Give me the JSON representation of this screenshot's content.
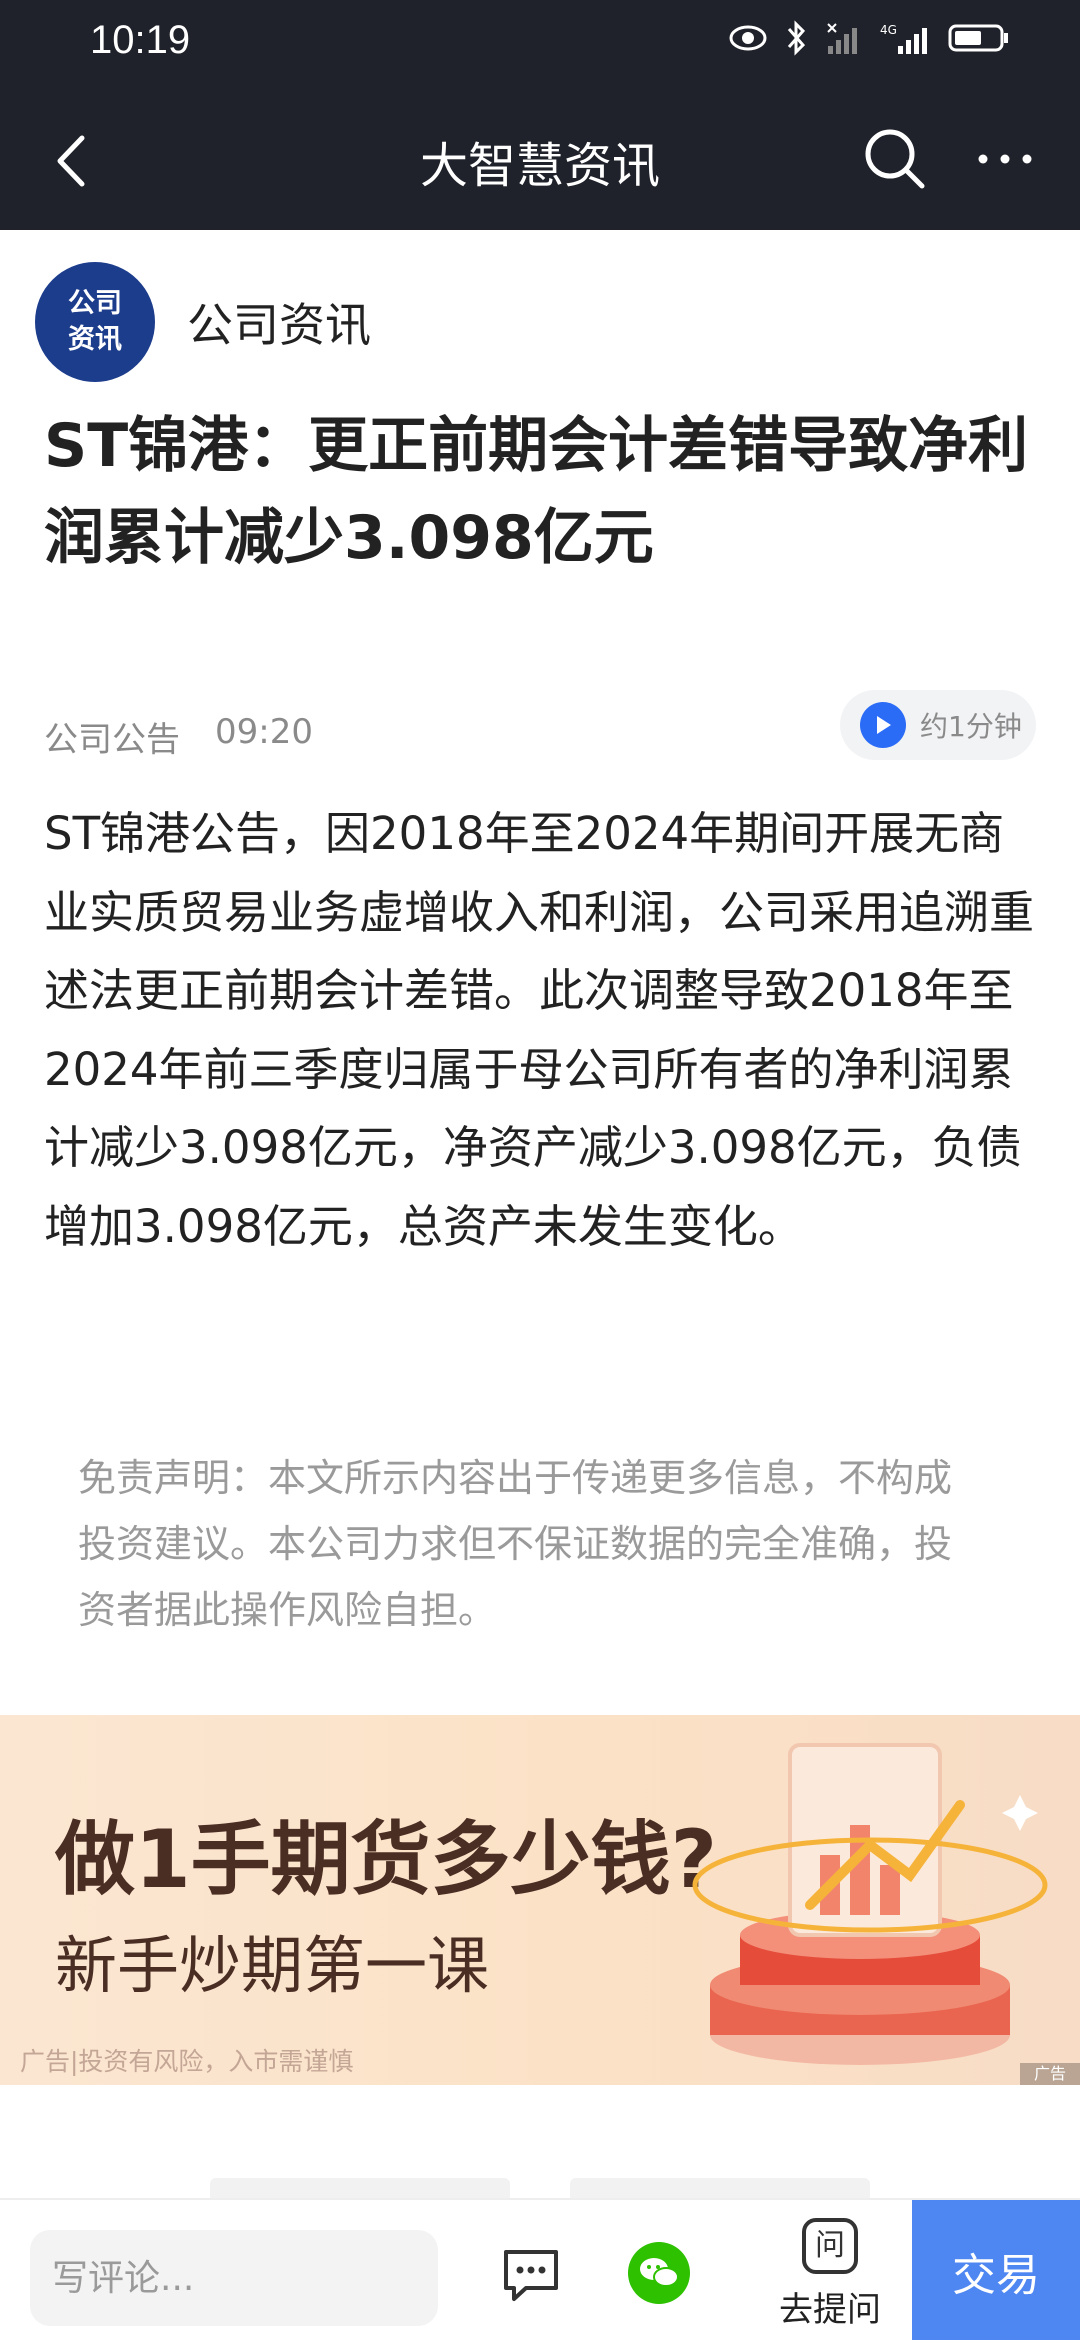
{
  "status_bar": {
    "time": "10:19",
    "icons": [
      "eye-icon",
      "bluetooth-icon",
      "signal-icon",
      "4g-signal-icon",
      "battery-icon"
    ]
  },
  "header": {
    "title": "大智慧资讯",
    "back_icon": "chevron-left-icon",
    "search_icon": "search-icon",
    "more_icon": "more-icon"
  },
  "source": {
    "logo_text_line1": "公司",
    "logo_text_line2": "资讯",
    "name": "公司资讯"
  },
  "article": {
    "headline": "ST锦港：更正前期会计差错导致净利润累计减少3.098亿元",
    "meta_source": "公司公告",
    "meta_time": "09:20",
    "listen_label": "约1分钟",
    "body": "ST锦港公告，因2018年至2024年期间开展无商业实质贸易业务虚增收入和利润，公司采用追溯重述法更正前期会计差错。此次调整导致2018年至2024年前三季度归属于母公司所有者的净利润累计减少3.098亿元，净资产减少3.098亿元，负债增加3.098亿元，总资产未发生变化。",
    "disclaimer": "免责声明：本文所示内容出于传递更多信息，不构成投资建议。本公司力求但不保证数据的完全准确，投资者据此操作风险自担。"
  },
  "ad": {
    "title": "做1手期货多少钱?",
    "subtitle": "新手炒期第一课",
    "note": "广告|投资有风险，入市需谨慎",
    "tag": "广告"
  },
  "bottom_bar": {
    "comment_placeholder": "写评论...",
    "ask_icon_text": "问",
    "ask_label": "去提问",
    "trade_label": "交易"
  },
  "colors": {
    "header_bg": "#1f222a",
    "accent_blue": "#4e86f2",
    "play_blue": "#2b6cf6",
    "wechat_green": "#2dc100",
    "ad_text": "#4a2e24"
  }
}
